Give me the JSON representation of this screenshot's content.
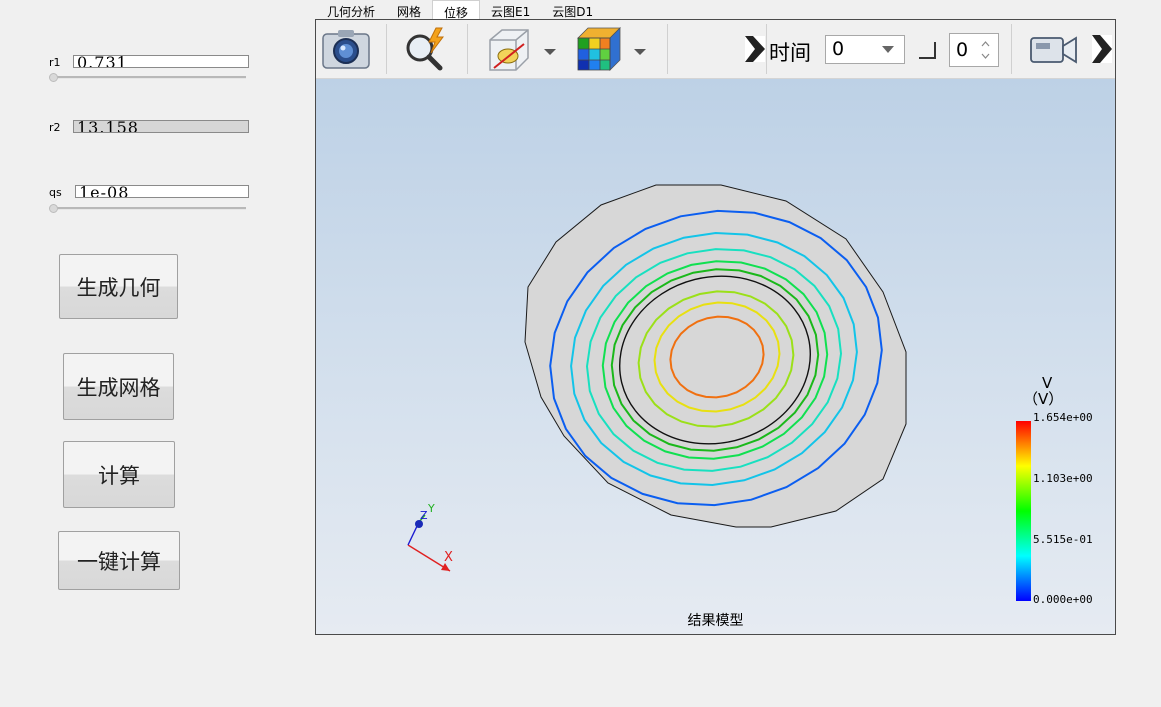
{
  "params": [
    {
      "label": "r1",
      "value": "0.731",
      "disabled": false,
      "has_slider": true
    },
    {
      "label": "r2",
      "value": "13.158",
      "disabled": true,
      "has_slider": false
    },
    {
      "label": "qs",
      "value": "1e-08",
      "disabled": false,
      "has_slider": true
    }
  ],
  "buttons": {
    "gen_geometry": "生成几何",
    "gen_mesh": "生成网格",
    "compute": "计算",
    "one_click": "一键计算"
  },
  "tabs": [
    "几何分析",
    "网格",
    "位移",
    "云图E1",
    "云图D1"
  ],
  "active_tab": 2,
  "toolbar": {
    "time_label": "时间",
    "time_value": "0",
    "step_value": "0",
    "icons": [
      "camera-icon",
      "quick-search-icon",
      "clip-view-icon",
      "colormap-cube-icon",
      "camera-video-icon"
    ]
  },
  "viewer": {
    "footer": "结果模型",
    "legend": {
      "title_line1": "V",
      "title_line2": "（V）",
      "ticks": [
        "1.654e+00",
        "1.103e+00",
        "5.515e-01",
        "0.000e+00"
      ]
    },
    "axes": {
      "x": "X",
      "y": "Y",
      "z": "Z"
    },
    "contour_colors": [
      "#0b5ef0",
      "#13c4e8",
      "#18e0c0",
      "#10e050",
      "#1ab81a",
      "#9be018",
      "#e8e010",
      "#f07010"
    ]
  }
}
